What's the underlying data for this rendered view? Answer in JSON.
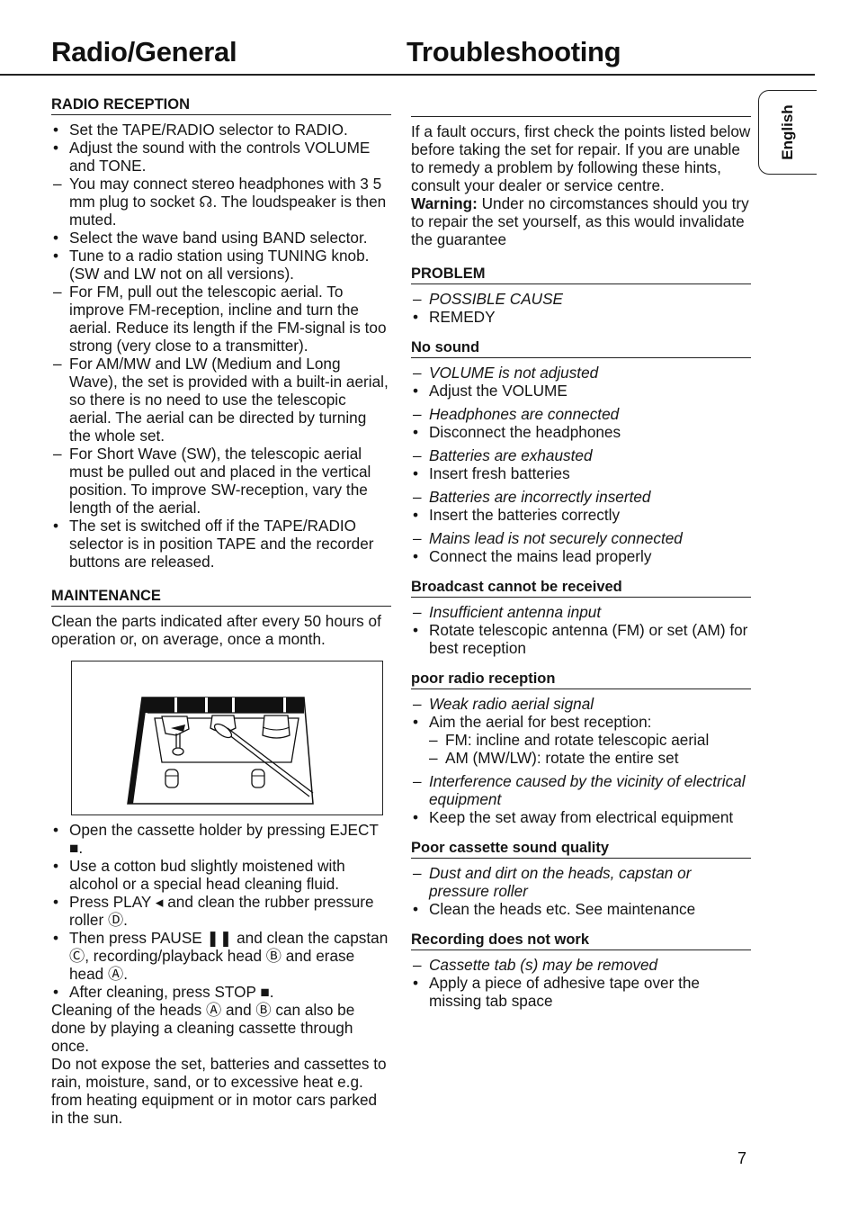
{
  "header": {
    "left_title": "Radio/General",
    "right_title": "Troubleshooting"
  },
  "language_tab": "English",
  "page_number": "7",
  "left_column": {
    "radio_reception": {
      "heading": "RADIO RECEPTION",
      "items": [
        {
          "marker": "•",
          "text": "Set the TAPE/RADIO selector to RADIO."
        },
        {
          "marker": "•",
          "text": "Adjust the sound with the controls VOLUME and TONE."
        },
        {
          "marker": "–",
          "text": "You may connect stereo headphones with 3 5 mm plug to socket ☊. The loudspeaker is then muted."
        },
        {
          "marker": "•",
          "text": "Select the wave band using BAND selector."
        },
        {
          "marker": "•",
          "text": "Tune to a radio station using TUNING knob. (SW and LW not on all versions)."
        },
        {
          "marker": "–",
          "text": "For FM, pull out the telescopic aerial. To improve FM-reception, incline and turn the aerial. Reduce its length if the FM-signal is too strong (very close to a transmitter)."
        },
        {
          "marker": "–",
          "text": "For AM/MW and LW (Medium and Long Wave), the set is provided with a built-in aerial, so there is no need to use the telescopic aerial. The aerial can be directed by turning the whole set."
        },
        {
          "marker": "–",
          "text": "For Short Wave (SW), the telescopic aerial must be pulled out and placed in the vertical position. To improve SW-reception, vary the length of the aerial."
        },
        {
          "marker": "•",
          "text": "The set is switched off if the TAPE/RADIO selector is in position TAPE and the recorder buttons are released."
        }
      ]
    },
    "maintenance": {
      "heading": "MAINTENANCE",
      "intro": "Clean the parts indicated after every 50 hours of operation or, on average, once a month.",
      "figure_alt": "Cassette deck heads being cleaned with a cotton bud",
      "items": [
        {
          "marker": "•",
          "text": "Open the cassette holder by pressing EJECT ■."
        },
        {
          "marker": "•",
          "text": "Use a cotton bud slightly moistened with alcohol or a special head cleaning fluid."
        },
        {
          "marker": "•",
          "text": "Press PLAY ◂ and clean the rubber pressure roller Ⓓ."
        },
        {
          "marker": "•",
          "text": "Then press PAUSE ❚❚ and clean the capstan Ⓒ, recording/playback head Ⓑ and erase head Ⓐ."
        },
        {
          "marker": "•",
          "text": "After cleaning, press STOP ■."
        }
      ],
      "para1": "Cleaning of the heads Ⓐ and Ⓑ can also be done by playing a cleaning cassette through once.",
      "para2": "Do not expose the set, batteries and cassettes to rain, moisture, sand, or to excessive heat e.g. from heating equipment or in motor cars parked in the sun."
    }
  },
  "right_column": {
    "intro": "If a fault occurs, first check the points listed below before taking the set for repair. If you are unable to remedy a problem by following these hints, consult your dealer or service centre.",
    "warning_label": "Warning:",
    "warning_text": " Under no circomstances should you try to repair the set yourself, as this would invalidate the guarantee",
    "legend": {
      "heading": "PROBLEM",
      "cause": "POSSIBLE CAUSE",
      "remedy": "REMEDY"
    },
    "problems": [
      {
        "heading": "No sound",
        "entries": [
          {
            "cause": "VOLUME is not adjusted",
            "remedy": "Adjust the VOLUME"
          },
          {
            "cause": "Headphones are connected",
            "remedy": "Disconnect the headphones"
          },
          {
            "cause": "Batteries are exhausted",
            "remedy": "Insert fresh batteries"
          },
          {
            "cause": "Batteries are incorrectly inserted",
            "remedy": "Insert the batteries correctly"
          },
          {
            "cause": "Mains lead is not securely connected",
            "remedy": "Connect the mains lead properly"
          }
        ]
      },
      {
        "heading": "Broadcast cannot be received",
        "entries": [
          {
            "cause": "Insufficient antenna input",
            "remedy": "Rotate telescopic antenna (FM) or set (AM) for best reception"
          }
        ]
      },
      {
        "heading": "poor radio reception",
        "entries": [
          {
            "cause": "Weak radio aerial signal",
            "remedy": "Aim  the aerial for best reception:",
            "sub": [
              "FM: incline and rotate telescopic aerial",
              "AM (MW/LW): rotate the entire set"
            ]
          },
          {
            "cause": "Interference caused by the vicinity of electrical equipment",
            "remedy": "Keep the set away from electrical equipment"
          }
        ]
      },
      {
        "heading": "Poor cassette sound quality",
        "entries": [
          {
            "cause": "Dust and dirt on the heads, capstan or pressure roller",
            "remedy": "Clean the heads etc. See maintenance"
          }
        ]
      },
      {
        "heading": "Recording does not work",
        "entries": [
          {
            "cause": "Cassette tab (s) may be removed",
            "remedy": "Apply a piece of adhesive tape over the missing tab space"
          }
        ]
      }
    ]
  }
}
